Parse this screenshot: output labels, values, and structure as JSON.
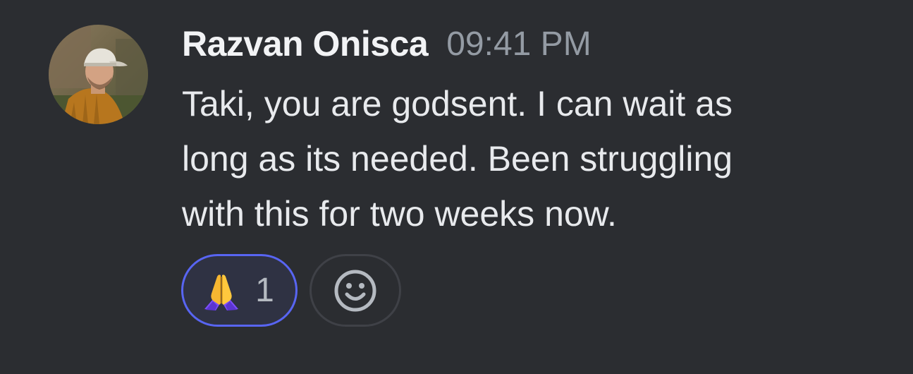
{
  "message": {
    "author": "Razvan Onisca",
    "timestamp": "09:41 PM",
    "text": "Taki, you are godsent. I can wait as\nlong as its needed. Been struggling\nwith this for two weeks now.",
    "avatar_icon": "user-avatar-photo"
  },
  "reactions": [
    {
      "emoji_icon": "folded-hands-emoji",
      "count": "1",
      "selected": true
    }
  ],
  "add_reaction": {
    "icon": "smiley-face-icon"
  },
  "colors": {
    "background": "#2b2d31",
    "author": "#f2f3f5",
    "timestamp": "#949ba4",
    "text": "#e8eaed",
    "reaction_border_active": "#5865f2",
    "reaction_bg_active": "#2f3243",
    "add_reaction_border": "#3f4147"
  }
}
